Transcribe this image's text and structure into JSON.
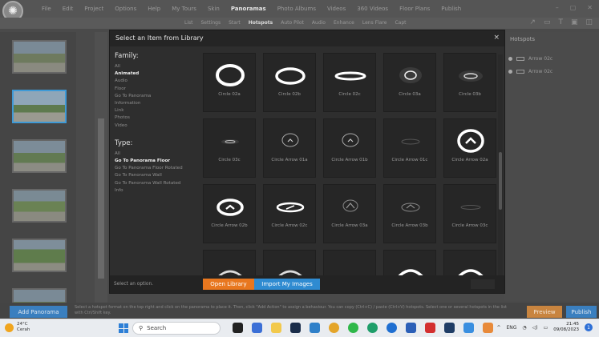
{
  "menubar": {
    "items": [
      "File",
      "Edit",
      "Project",
      "Options",
      "Help",
      "My Tours",
      "Skin",
      "Panoramas",
      "Photo Albums",
      "Videos",
      "360 Videos",
      "Floor Plans",
      "Publish"
    ],
    "active": "Panoramas"
  },
  "subbar": {
    "items": [
      "List",
      "Settings",
      "Start",
      "Hotspots",
      "Auto Pilot",
      "Audio",
      "Enhance",
      "Lens Flare",
      "Capt"
    ],
    "active": "Hotspots"
  },
  "right_panel": {
    "title": "Hotspots",
    "rows": [
      "Arrow 02c",
      "Arrow 02c"
    ]
  },
  "bottombar": {
    "add_panorama": "Add Panorama",
    "hint": "Select a hotspot format on the top right and click on the panorama to place it. Then, click \"Add Action\" to assign a behaviour. You can copy (Ctrl+C) / paste (Ctrl+V) hotspots. Select one or several hotspots in the list with Ctrl/Shift key.",
    "preview": "Preview",
    "publish": "Publish"
  },
  "modal": {
    "title": "Select an Item from Library",
    "close": "×",
    "family_heading": "Family:",
    "family": [
      "All",
      "Animated",
      "Audio",
      "Floor",
      "Go To Panorama",
      "Information",
      "Link",
      "Photos",
      "Video"
    ],
    "family_selected": "Animated",
    "type_heading": "Type:",
    "type": [
      "All",
      "Go To Panorama Floor",
      "Go To Panorama Floor Rotated",
      "Go To Panorama Wall",
      "Go To Panorama Wall Rotated",
      "Info"
    ],
    "type_selected": "Go To Panorama Floor",
    "items": [
      {
        "label": "Circle 02a",
        "icon": "ring-thick-icon"
      },
      {
        "label": "Circle 02b",
        "icon": "ring-ellipse-icon"
      },
      {
        "label": "Circle 02c",
        "icon": "ring-flat-icon"
      },
      {
        "label": "Circle 03a",
        "icon": "ring-glow-icon"
      },
      {
        "label": "Circle 03b",
        "icon": "ring-glow-flat-icon"
      },
      {
        "label": "Circle 03c",
        "icon": "ring-tiny-icon"
      },
      {
        "label": "Circle Arrow 01a",
        "icon": "arrow-ring-dim-icon"
      },
      {
        "label": "Circle Arrow 01b",
        "icon": "arrow-ring-dim-icon"
      },
      {
        "label": "Circle Arrow 01c",
        "icon": "arrow-ring-faint-icon"
      },
      {
        "label": "Circle Arrow 02a",
        "icon": "arrow-ring-bright-icon"
      },
      {
        "label": "Circle Arrow 02b",
        "icon": "arrow-ellipse-bright-icon"
      },
      {
        "label": "Circle Arrow 02c",
        "icon": "arrow-ellipse-flat-icon"
      },
      {
        "label": "Circle Arrow 03a",
        "icon": "arrow-diamond-icon"
      },
      {
        "label": "Circle Arrow 03b",
        "icon": "arrow-diamond-flat-icon"
      },
      {
        "label": "Circle Arrow 03c",
        "icon": "arrow-faint-icon"
      },
      {
        "label": "",
        "icon": "arc-partial-icon"
      },
      {
        "label": "",
        "icon": "arc-partial-icon"
      },
      {
        "label": "",
        "icon": "empty-icon"
      },
      {
        "label": "",
        "icon": "arc-bright-icon"
      },
      {
        "label": "",
        "icon": "arc-bright-icon"
      }
    ],
    "footer_text": "Select an option.",
    "open_library": "Open Library",
    "import_images": "Import My Images"
  },
  "taskbar": {
    "temperature": "24°C",
    "condition": "Cerah",
    "search": "Search",
    "language": "ENG",
    "time": "21:45",
    "date": "09/08/2023",
    "notifications": "1"
  },
  "colors": {
    "accent_orange": "#e8771f",
    "accent_blue": "#2f8bd1",
    "modal_bg": "#2e2e2e"
  }
}
